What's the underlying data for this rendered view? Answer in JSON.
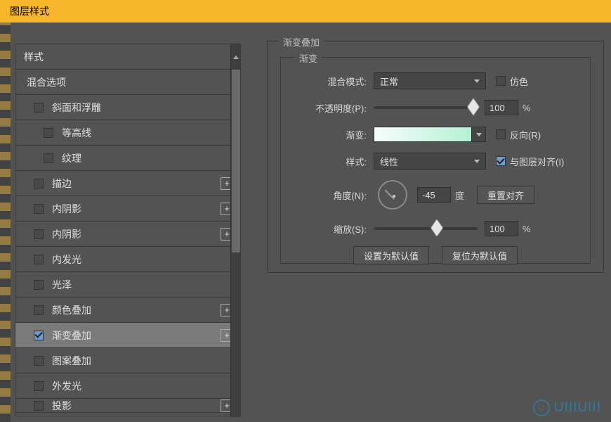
{
  "title": "图层样式",
  "sidebar": {
    "header": "样式",
    "items": [
      {
        "label": "混合选项",
        "chk": null,
        "plus": false,
        "indent": false
      },
      {
        "label": "斜面和浮雕",
        "chk": false,
        "plus": false,
        "indent": true
      },
      {
        "label": "等高线",
        "chk": false,
        "plus": false,
        "indent": true,
        "sub": true
      },
      {
        "label": "纹理",
        "chk": false,
        "plus": false,
        "indent": true,
        "sub": true
      },
      {
        "label": "描边",
        "chk": false,
        "plus": true,
        "indent": true
      },
      {
        "label": "内阴影",
        "chk": false,
        "plus": true,
        "indent": true
      },
      {
        "label": "内阴影",
        "chk": false,
        "plus": true,
        "indent": true
      },
      {
        "label": "内发光",
        "chk": false,
        "plus": false,
        "indent": true
      },
      {
        "label": "光泽",
        "chk": false,
        "plus": false,
        "indent": true
      },
      {
        "label": "颜色叠加",
        "chk": false,
        "plus": true,
        "indent": true
      },
      {
        "label": "渐变叠加",
        "chk": true,
        "plus": true,
        "indent": true,
        "selected": true
      },
      {
        "label": "图案叠加",
        "chk": false,
        "plus": false,
        "indent": true
      },
      {
        "label": "外发光",
        "chk": false,
        "plus": false,
        "indent": true
      },
      {
        "label": "投影",
        "chk": false,
        "plus": true,
        "indent": true,
        "cut": true
      }
    ]
  },
  "panel": {
    "group": "渐变叠加",
    "inner": "渐变",
    "blend_label": "混合模式:",
    "blend_value": "正常",
    "dither": {
      "label": "仿色",
      "on": false
    },
    "opacity_label": "不透明度(P):",
    "opacity_value": "100",
    "grad_label": "渐变:",
    "reverse": {
      "label": "反向(R)",
      "on": false
    },
    "style_label": "样式:",
    "style_value": "线性",
    "align": {
      "label": "与图层对齐(I)",
      "on": true
    },
    "angle_label": "角度(N):",
    "angle_value": "-45",
    "angle_unit": "度",
    "reset_align": "重置对齐",
    "scale_label": "缩放(S):",
    "scale_value": "100",
    "set_default": "设置为默认值",
    "reset_default": "复位为默认值",
    "pct": "%"
  },
  "logo": "UIIIUIII"
}
